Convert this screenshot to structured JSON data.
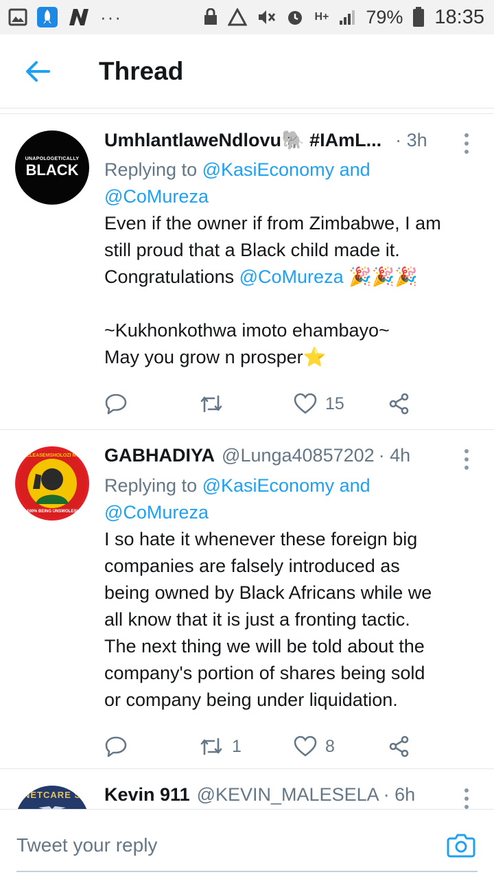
{
  "status_bar": {
    "battery": "79%",
    "time": "18:35",
    "network": "H+"
  },
  "header": {
    "title": "Thread",
    "back_icon": "arrow-left-icon"
  },
  "tweets": [
    {
      "name": "UmhlantlaweNdlovu🐘 #IAmL...",
      "handle": "",
      "time": "· 3h",
      "replying_prefix": "Replying to ",
      "replying_1": "@KasiEconomy",
      "replying_and": " and",
      "replying_2": "@CoMureza",
      "lines": [
        "Even if the owner if from Zimbabwe, I am",
        "still proud that a Black child made it.",
        "Congratulations ",
        "@CoMureza",
        " 🎉🎉🎉",
        "",
        "~Kukhonkothwa imoto ehambayo~",
        "May you grow n prosper⭐"
      ],
      "avatar_text_small": "UNAPOLOGETICALLY",
      "avatar_text_big": "BLACK",
      "retweets": "",
      "likes": "15"
    },
    {
      "name": "GABHADIYA",
      "handle": "@Lunga40857202",
      "time": "· 4h",
      "replying_prefix": "Replying to ",
      "replying_1": "@KasiEconomy",
      "replying_and": " and",
      "replying_2": "@CoMureza",
      "lines": [
        "I so hate it whenever these foreign big",
        "companies are falsely introduced as",
        "being owned by Black Africans while we",
        "all know that it is just a fronting tactic.",
        "The next thing we will be told about the",
        "company's portion of shares being sold",
        "or company being under liquidation."
      ],
      "avatar_text_top": "#RELEASEMSHOLOZI NOW",
      "avatar_text_bottom": "100% BEING UNSWOLESI",
      "retweets": "1",
      "likes": "8"
    },
    {
      "name": "Kevin 911",
      "handle": "@KEVIN_MALESELA",
      "time": "· 6h",
      "avatar_text": "NETCARE S"
    }
  ],
  "composer": {
    "placeholder": "Tweet your reply",
    "camera_icon": "camera-icon"
  },
  "colors": {
    "accent": "#1da1f2",
    "muted": "#657786"
  }
}
